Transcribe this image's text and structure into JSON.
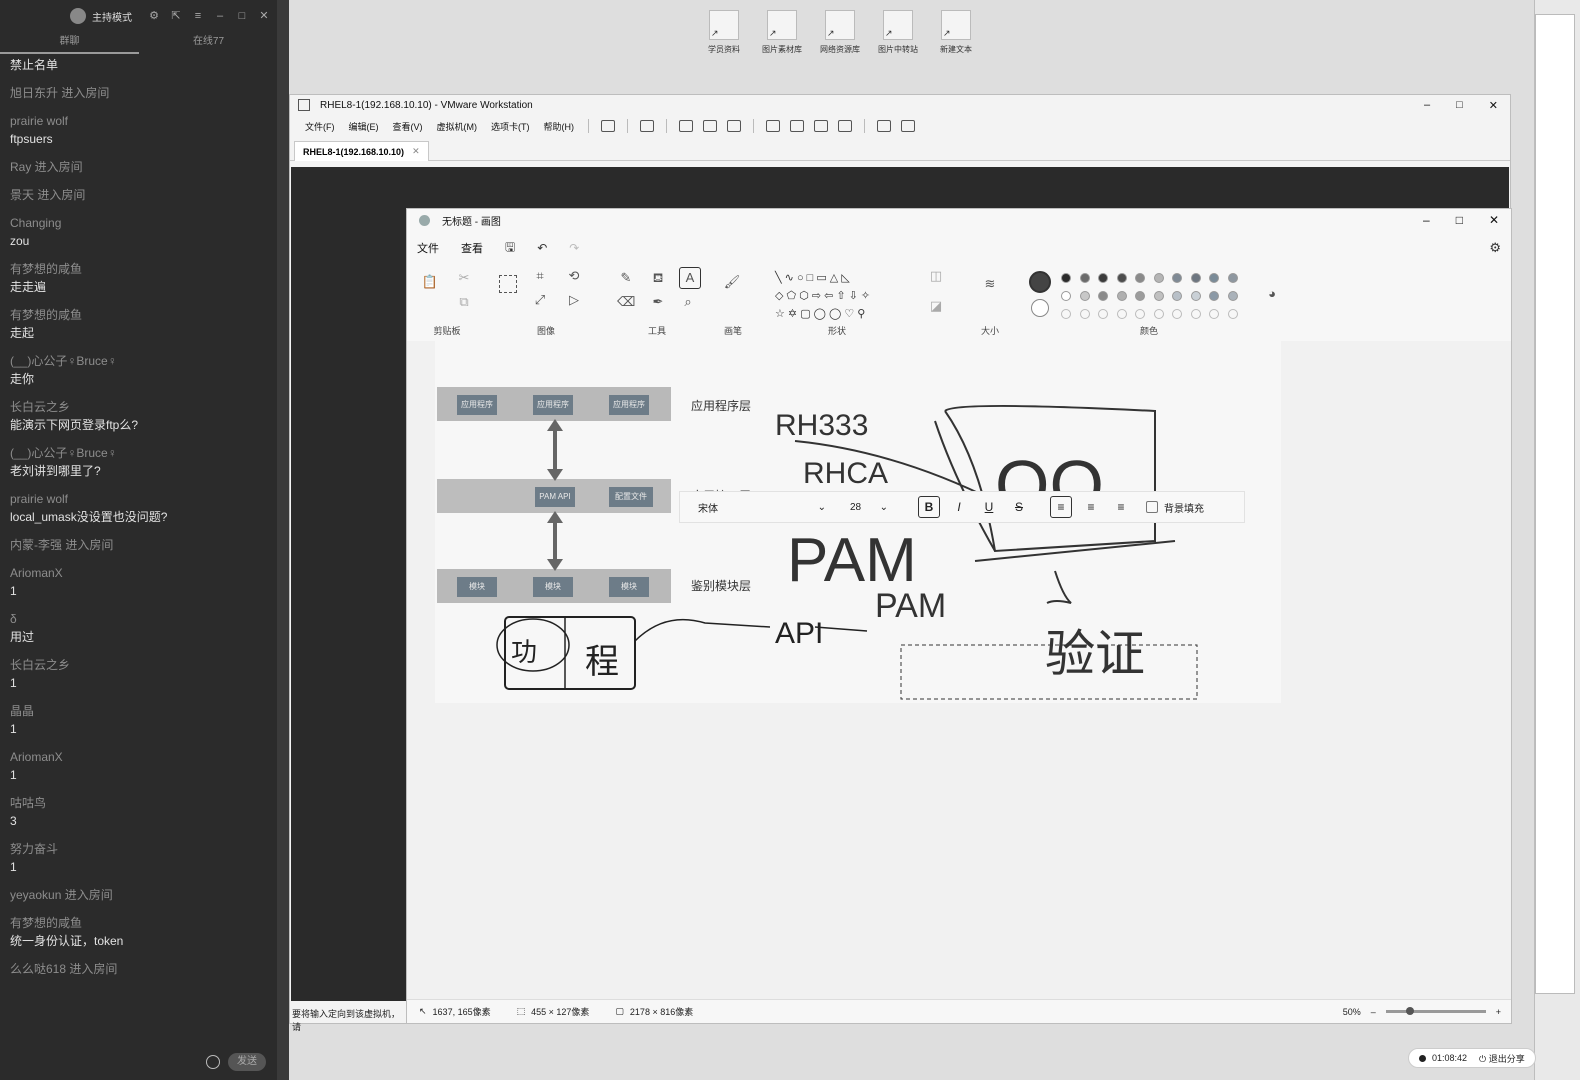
{
  "chat": {
    "host_label": "主持模式",
    "tabs": [
      "群聊",
      "在线77"
    ],
    "messages": [
      {
        "nick": "",
        "text": "禁止名单"
      },
      {
        "nick": "旭日东升 进入房间",
        "text": ""
      },
      {
        "nick": "prairie wolf",
        "text": "ftpsuers"
      },
      {
        "nick": "Ray 进入房间",
        "text": ""
      },
      {
        "nick": "景天 进入房间",
        "text": ""
      },
      {
        "nick": "Changing",
        "text": "zou"
      },
      {
        "nick": "有梦想的咸鱼",
        "text": "走走遍"
      },
      {
        "nick": "有梦想的咸鱼",
        "text": "走起"
      },
      {
        "nick": "(__)心公子♀Bruce♀",
        "text": "走你"
      },
      {
        "nick": "长白云之乡",
        "text": "能演示下网页登录ftp么?"
      },
      {
        "nick": "(__)心公子♀Bruce♀",
        "text": "老刘讲到哪里了?"
      },
      {
        "nick": "prairie wolf",
        "text": "local_umask没设置也没问题?"
      },
      {
        "nick": "内蒙-李强 进入房间",
        "text": ""
      },
      {
        "nick": "AriomanX",
        "text": "1"
      },
      {
        "nick": "δ",
        "text": "用过"
      },
      {
        "nick": "长白云之乡",
        "text": "1"
      },
      {
        "nick": "晶晶",
        "text": "1"
      },
      {
        "nick": "AriomanX",
        "text": "1"
      },
      {
        "nick": "咕咕鸟",
        "text": "3"
      },
      {
        "nick": "努力奋斗",
        "text": "1"
      },
      {
        "nick": "yeyaokun 进入房间",
        "text": ""
      },
      {
        "nick": "有梦想的咸鱼",
        "text": "统一身份认证，token"
      },
      {
        "nick": "么么哒618 进入房间",
        "text": ""
      }
    ],
    "send_label": "发送"
  },
  "desktop_icons": [
    "学员资料",
    "图片素材库",
    "网络资源库",
    "图片中转站",
    "新建文本"
  ],
  "vmware": {
    "title": "RHEL8-1(192.168.10.10) - VMware Workstation",
    "menus": [
      "文件(F)",
      "编辑(E)",
      "查看(V)",
      "虚拟机(M)",
      "选项卡(T)",
      "帮助(H)"
    ],
    "tab_label": "RHEL8-1(192.168.10.10)",
    "status_text": "要将输入定向到该虚拟机，请"
  },
  "paint": {
    "title": "无标题 - 画图",
    "menus": [
      "文件",
      "查看"
    ],
    "groups": [
      "剪贴板",
      "图像",
      "工具",
      "画笔",
      "形状",
      "大小",
      "颜色"
    ],
    "textbar": {
      "font": "宋体",
      "size": "28",
      "fill_label": "背景填充"
    },
    "status": {
      "cursor": "1637, 165像素",
      "selection": "455 × 127像素",
      "canvas": "2178 × 816像素",
      "zoom": "50%"
    },
    "colors": {
      "row1": [
        "#2b2b2b",
        "#6b6b6b",
        "#3b3b3b",
        "#4d4d4d",
        "#8a8a8a",
        "#b5b5b5",
        "#7f8a95",
        "#6d7680",
        "#7a8b98",
        "#8e97a0"
      ],
      "row2": [
        "#ffffff",
        "#c8c8c8",
        "#8a8a8a",
        "#b0b0b0",
        "#9c9c9c",
        "#c0c0c0",
        "#b8c0c8",
        "#c9d0d6",
        "#8b99a6",
        "#aab2ba"
      ]
    }
  },
  "diagram": {
    "row_labels": [
      "应用程序层",
      "应用接口层",
      "鉴别模块层"
    ],
    "app_boxes": [
      "应用程序",
      "应用程序",
      "应用程序"
    ],
    "api_box": "PAM API",
    "config_box": "配置文件",
    "module_boxes": [
      "模块",
      "模块",
      "模块"
    ],
    "handwriting": [
      "RH333",
      "RHCA",
      "QQ",
      "PAM",
      "PAM",
      "功",
      "程",
      "API",
      "验证"
    ]
  },
  "timer": {
    "time": "01:08:42",
    "exit_label": "退出分享"
  }
}
